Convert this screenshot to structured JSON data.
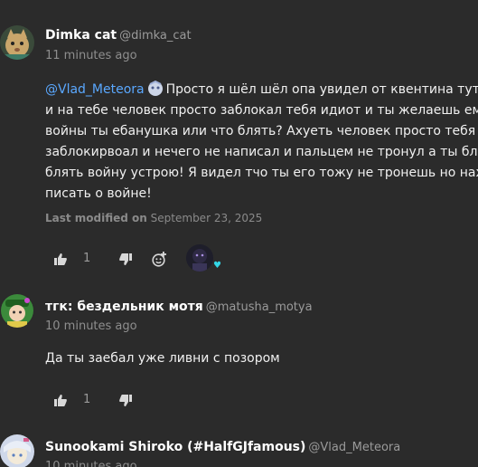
{
  "posts": [
    {
      "author_name": "Dimka cat",
      "author_handle": "@dimka_cat",
      "time": "11 minutes ago",
      "mention": "@Vlad_Meteora",
      "lines": [
        "Просто я шёл шёл опа увидел от квентина тут пос",
        "и на тебе  человек просто заблокал тебя идиот и ты желаешь ему",
        "войны ты ебанушка или что блять? Ахуеть человек просто тебя",
        "заблокирвоал и нечего не написал и пальцем не тронул а ты блять э",
        "блять войну устрою! Я видел тчо ты его тожу не тронешь но нахуй",
        "писать о войне!"
      ],
      "modified_label": "Last modified on",
      "modified_date": "September 23, 2025",
      "likes": "1"
    },
    {
      "author_name": "тгк: бездельник мотя",
      "author_handle": "@matusha_motya",
      "time": "10 minutes ago",
      "lines": [
        "Да ты заебал уже ливни с позором"
      ],
      "likes": "1"
    },
    {
      "author_name": "Sunookami Shiroko (#HalfGJfamous)",
      "author_handle": "@Vlad_Meteora",
      "time": "10 minutes ago"
    }
  ],
  "icons": {
    "like": "thumbs-up-icon",
    "dislike": "thumbs-down-icon",
    "add_reaction": "add-reaction-icon",
    "heart": "heart-icon"
  },
  "colors": {
    "background": "#2b2b2b",
    "mention": "#5aa8ff",
    "heart": "#33d6e6"
  }
}
